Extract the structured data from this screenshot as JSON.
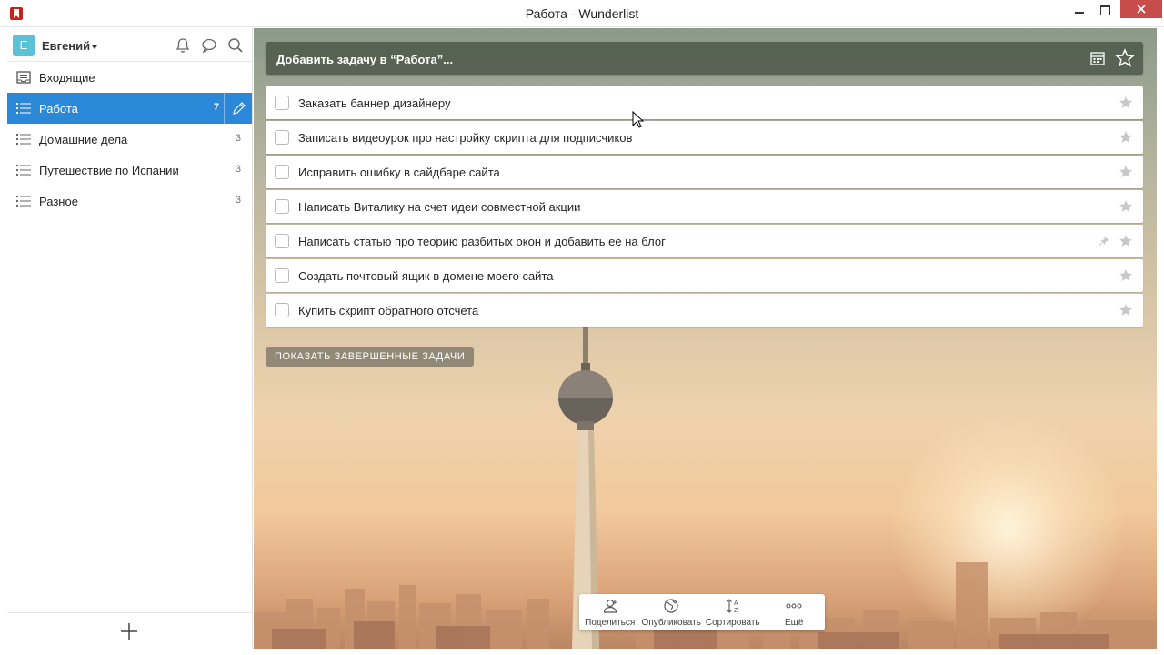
{
  "window": {
    "title": "Работа - Wunderlist"
  },
  "sidebar": {
    "user": {
      "initial": "E",
      "name": "Евгений"
    },
    "items": [
      {
        "label": "Входящие",
        "count": "",
        "icon": "inbox-icon",
        "active": false
      },
      {
        "label": "Работа",
        "count": "7",
        "icon": "list-icon",
        "active": true
      },
      {
        "label": "Домашние дела",
        "count": "3",
        "icon": "list-icon",
        "active": false
      },
      {
        "label": "Путешествие по Испании",
        "count": "3",
        "icon": "list-icon",
        "active": false
      },
      {
        "label": "Разное",
        "count": "3",
        "icon": "list-icon",
        "active": false
      }
    ]
  },
  "add_task": {
    "placeholder": "Добавить задачу в “Работа”..."
  },
  "tasks": [
    {
      "text": "Заказать баннер дизайнеру",
      "starred": false,
      "pinned": false
    },
    {
      "text": "Записать видеоурок про настройку скрипта для подписчиков",
      "starred": false,
      "pinned": false
    },
    {
      "text": "Исправить ошибку в сайдбаре сайта",
      "starred": false,
      "pinned": false
    },
    {
      "text": "Написать Виталику на счет идеи совместной акции",
      "starred": false,
      "pinned": false
    },
    {
      "text": "Написать статью про теорию разбитых окон и добавить ее на блог",
      "starred": false,
      "pinned": true
    },
    {
      "text": "Создать почтовый ящик в домене моего сайта",
      "starred": false,
      "pinned": false
    },
    {
      "text": "Купить скрипт обратного отсчета",
      "starred": false,
      "pinned": false
    }
  ],
  "show_completed_label": "ПОКАЗАТЬ ЗАВЕРШЕННЫЕ ЗАДАЧИ",
  "toolbar": {
    "share_label": "Поделиться",
    "publish_label": "Опубликовать",
    "sort_label": "Сортировать",
    "more_label": "Ещё"
  },
  "colors": {
    "accent": "#2b88d9",
    "avatar": "#59c2d6",
    "close_button": "#c74d4d",
    "add_bar": "#4a5646"
  }
}
